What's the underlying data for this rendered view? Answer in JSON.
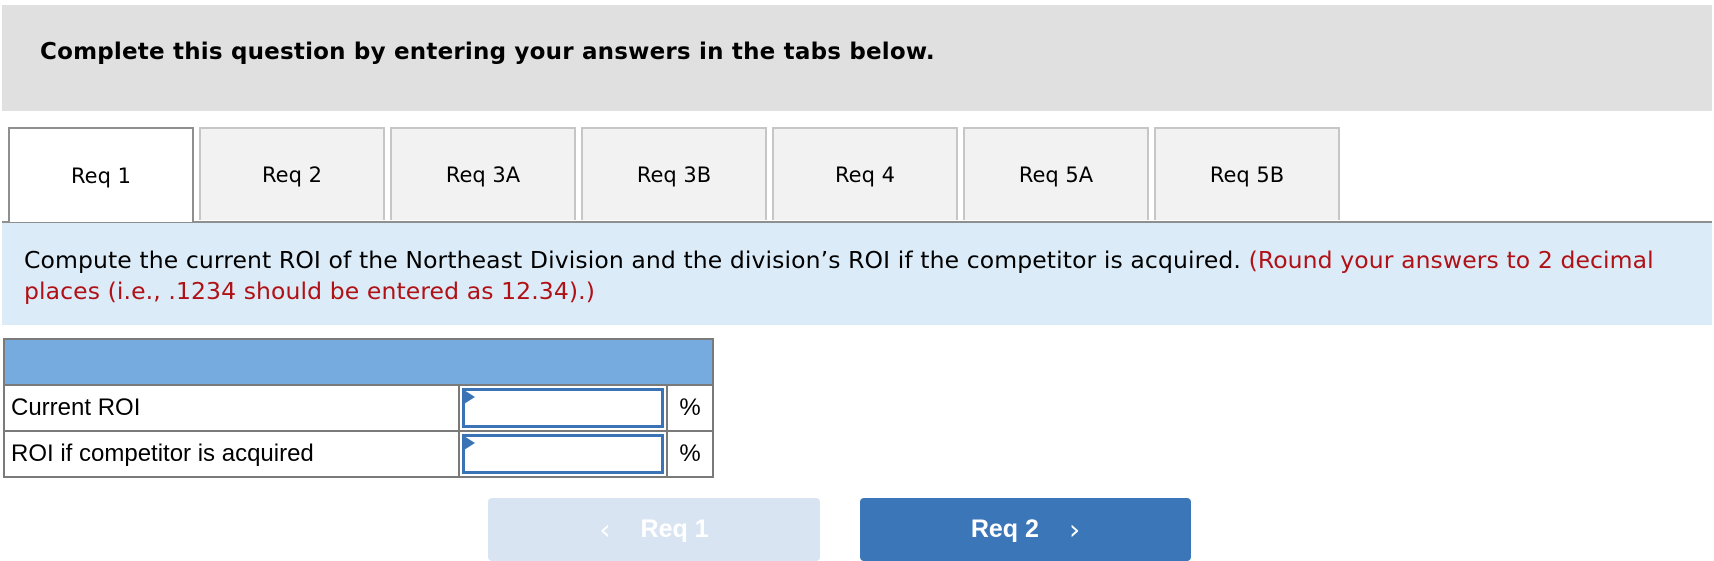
{
  "header": {
    "title": "Complete this question by entering your answers in the tabs below."
  },
  "tabs": [
    {
      "label": "Req 1",
      "active": true
    },
    {
      "label": "Req 2",
      "active": false
    },
    {
      "label": "Req 3A",
      "active": false
    },
    {
      "label": "Req 3B",
      "active": false
    },
    {
      "label": "Req 4",
      "active": false
    },
    {
      "label": "Req 5A",
      "active": false
    },
    {
      "label": "Req 5B",
      "active": false
    }
  ],
  "instructions": {
    "main": "Compute the current ROI of the Northeast Division and the division’s ROI if the competitor is acquired.",
    "note": "(Round your answers to 2 decimal places (i.e., .1234 should be entered as 12.34).)"
  },
  "table": {
    "rows": [
      {
        "label": "Current ROI",
        "value": "",
        "unit": "%"
      },
      {
        "label": "ROI if competitor is acquired",
        "value": "",
        "unit": "%"
      }
    ]
  },
  "navigation": {
    "prev": {
      "label": "Req 1",
      "icon": "chevron-left-icon",
      "glyph": "‹",
      "enabled": false
    },
    "next": {
      "label": "Req 2",
      "icon": "chevron-right-icon",
      "glyph": "›",
      "enabled": true
    }
  },
  "colors": {
    "header_bg": "#e0e0e0",
    "instruction_bg": "#dbebf7",
    "note_red": "#b01116",
    "table_header": "#76abe0",
    "input_border": "#3a74b6",
    "next_button": "#3a76b8",
    "prev_button_disabled": "#d8e4f1"
  }
}
